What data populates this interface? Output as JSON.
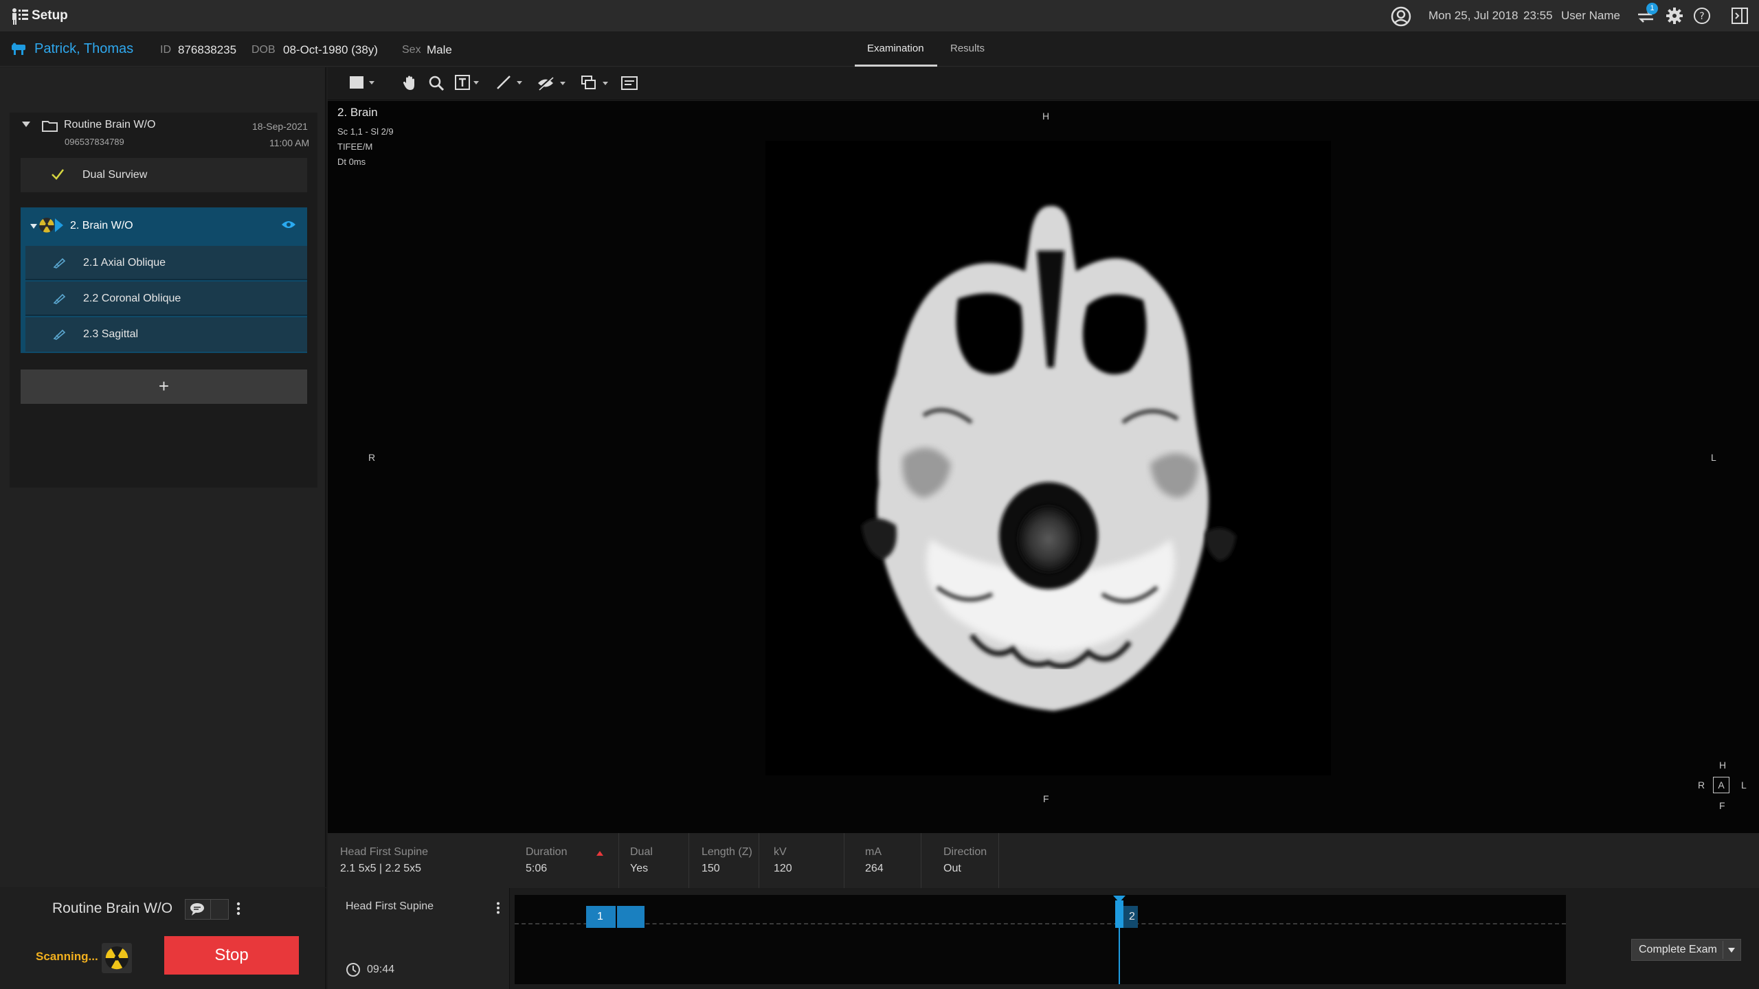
{
  "app": {
    "title": "Setup"
  },
  "status": {
    "date": "Mon 25, Jul 2018",
    "time": "23:55",
    "user": "User Name",
    "notifications": "1"
  },
  "patient": {
    "name": "Patrick, Thomas",
    "id_label": "ID",
    "id": "876838235",
    "dob_label": "DOB",
    "dob": "08-Oct-1980 (38y)",
    "sex_label": "Sex",
    "sex": "Male"
  },
  "tabs": [
    {
      "label": "Examination",
      "active": true
    },
    {
      "label": "Results",
      "active": false
    }
  ],
  "exam": {
    "title": "Routine Brain W/O",
    "accession": "096537834789",
    "date": "18-Sep-2021",
    "time": "11:00 AM",
    "survey": "Dual Surview",
    "active_scan": "2. Brain W/O",
    "sub_items": [
      "2.1 Axial Oblique",
      "2.2 Coronal Oblique",
      "2.3 Sagittal"
    ],
    "add_label": "+"
  },
  "viewer": {
    "series": "2. Brain",
    "info1": "Sc 1,1 - Sl 2/9",
    "info2": "TIFEE/M",
    "info3": "Dt 0ms",
    "orient_top": "H",
    "orient_bottom": "F",
    "orient_left": "R",
    "orient_right": "L",
    "cube": {
      "h": "H",
      "r": "R",
      "a": "A",
      "l": "L",
      "f": "F"
    }
  },
  "params": {
    "position_label": "Head First Supine",
    "position_value": "2.1 5x5  |  2.2 5x5",
    "duration_label": "Duration",
    "duration": "5:06",
    "dual_label": "Dual",
    "dual": "Yes",
    "length_label": "Length (Z)",
    "length": "150",
    "kv_label": "kV",
    "kv": "120",
    "ma_label": "mA",
    "ma": "264",
    "direction_label": "Direction",
    "direction": "Out"
  },
  "bottom": {
    "exam_title": "Routine Brain W/O",
    "scanning": "Scanning...",
    "stop": "Stop",
    "timeline_label": "Head First Supine",
    "timer": "09:44",
    "block1": "1",
    "block2": "2",
    "complete": "Complete Exam"
  },
  "colors": {
    "accent": "#1e9be0",
    "stop": "#e8383b",
    "scanning": "#f2b01e",
    "selected": "#0f4a69"
  }
}
